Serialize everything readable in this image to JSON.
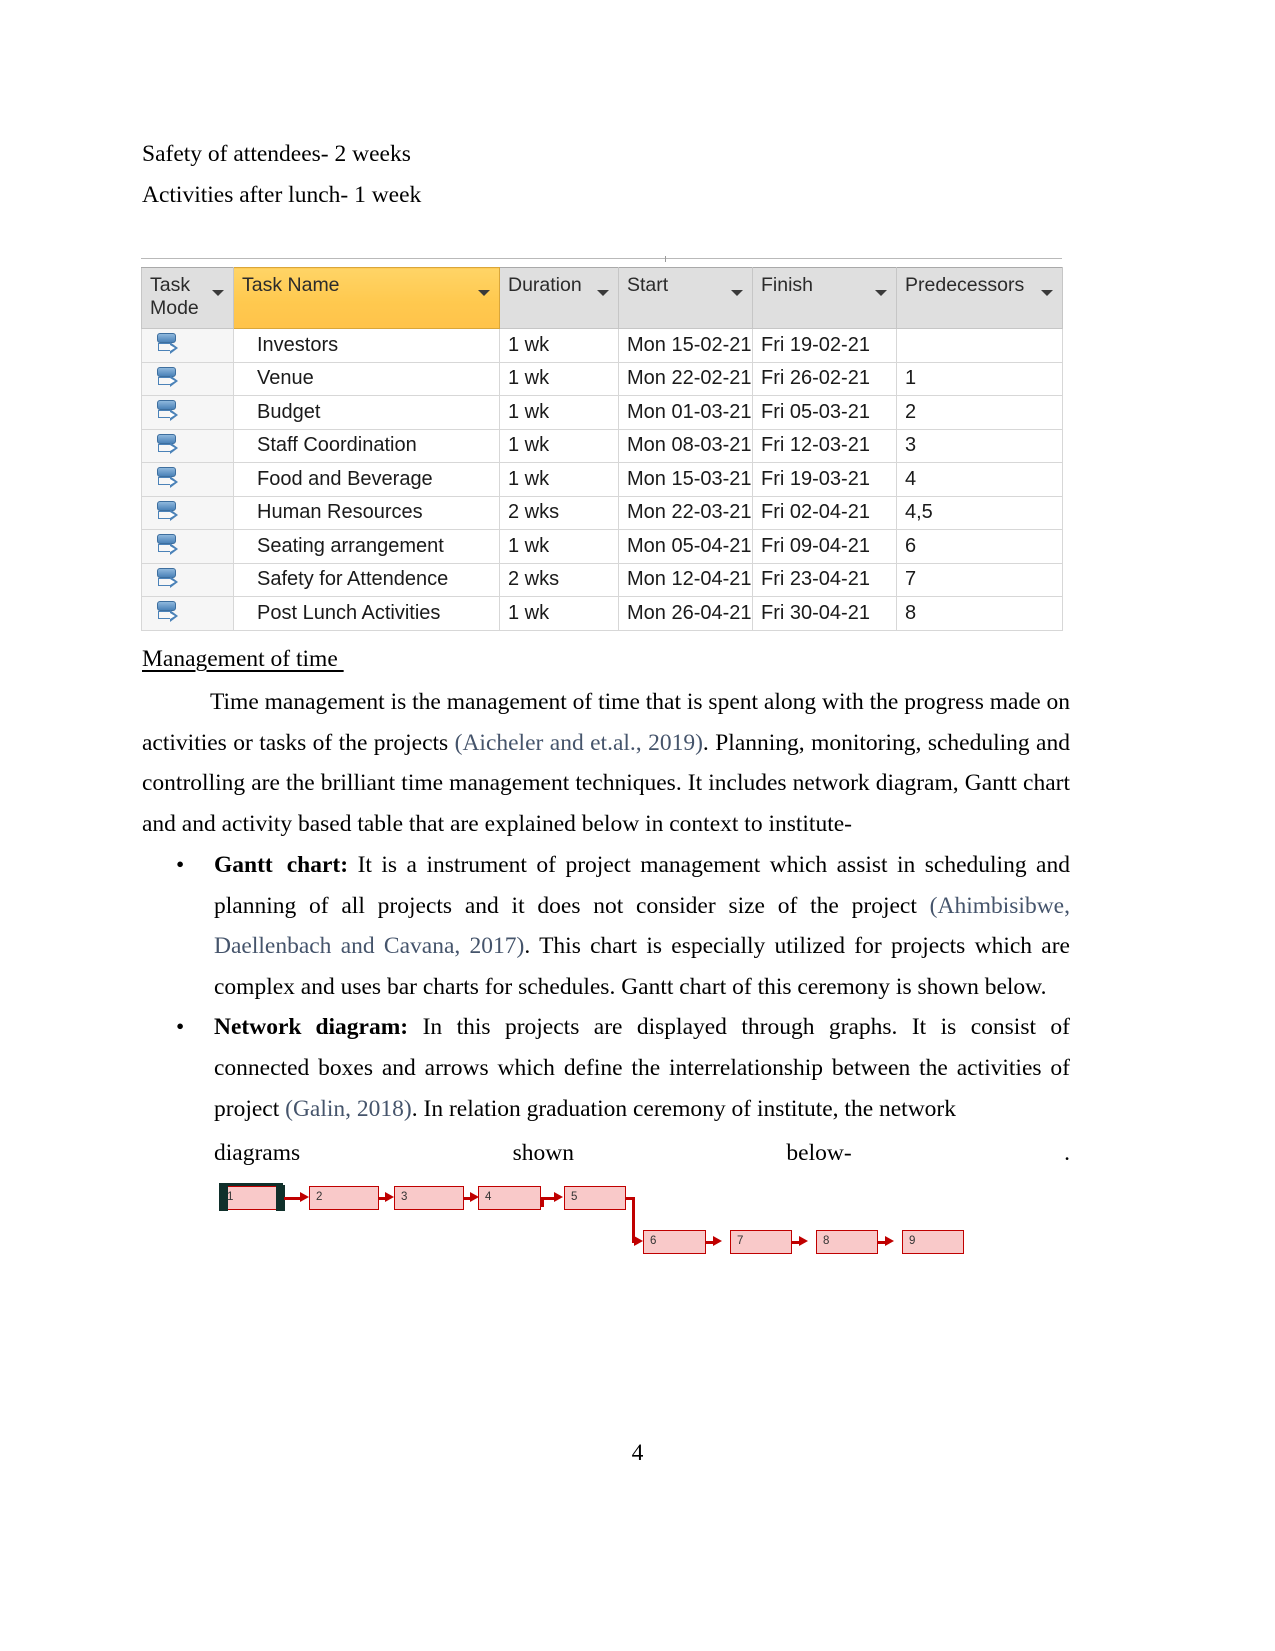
{
  "document": {
    "page_number": "4",
    "intro_lines": [
      "Safety of attendees- 2 weeks",
      "Activities after lunch- 1 week"
    ],
    "section_heading": "Management of time ",
    "paragraph": {
      "part1": "Time management is the management of time that is spent along with the progress made on activities or tasks of the projects ",
      "citation1": "(Aicheler and et.al., 2019)",
      "part2": ". Planning, monitoring, scheduling and controlling are the brilliant time management techniques. It includes network diagram, Gantt chart and and activity based table that are explained below in context to institute-"
    },
    "bullets": [
      {
        "marker": "•",
        "lead": "Gantt",
        "lead2": "chart:",
        "text1": " It is a instrument of project management which assist in scheduling and planning of all projects and it does not consider size of the project ",
        "citation": "(Ahimbisibwe, Daellenbach and Cavana, 2017)",
        "text2": ". This chart is especially utilized for projects which are complex and uses bar charts for schedules. Gantt chart of this ceremony is shown below."
      },
      {
        "marker": "•",
        "lead": "Network",
        "lead2": "diagram:",
        "text1": " In this projects are displayed through graphs. It is consist of connected boxes and arrows which define the interrelationship between the activities of project ",
        "citation": "(Galin, 2018)",
        "text2": ". In relation   graduation ceremony of institute, the network"
      }
    ],
    "tail_line": {
      "word1": "diagrams",
      "word2": "shown",
      "word3": "below-",
      "word4": "."
    }
  },
  "project_table": {
    "columns": [
      {
        "id": "task-mode",
        "label_line1": "Task",
        "label_line2": "Mode",
        "highlighted": false
      },
      {
        "id": "task-name",
        "label_line1": "Task Name",
        "label_line2": "",
        "highlighted": true
      },
      {
        "id": "duration",
        "label_line1": "Duration",
        "label_line2": "",
        "highlighted": false
      },
      {
        "id": "start",
        "label_line1": "Start",
        "label_line2": "",
        "highlighted": false
      },
      {
        "id": "finish",
        "label_line1": "Finish",
        "label_line2": "",
        "highlighted": false
      },
      {
        "id": "predecessors",
        "label_line1": "Predecessors",
        "label_line2": "",
        "highlighted": false
      }
    ],
    "highlight_color": "#ffc94f",
    "header_bg": "#dfdfdf",
    "rows": [
      {
        "mode_icon": "manually-scheduled-icon",
        "name": "Investors",
        "duration": "1 wk",
        "start": "Mon 15-02-21",
        "finish": "Fri 19-02-21",
        "predecessors": ""
      },
      {
        "mode_icon": "manually-scheduled-icon",
        "name": "Venue",
        "duration": "1 wk",
        "start": "Mon 22-02-21",
        "finish": "Fri 26-02-21",
        "predecessors": "1"
      },
      {
        "mode_icon": "manually-scheduled-icon",
        "name": "Budget",
        "duration": "1 wk",
        "start": "Mon 01-03-21",
        "finish": "Fri 05-03-21",
        "predecessors": "2"
      },
      {
        "mode_icon": "manually-scheduled-icon",
        "name": "Staff Coordination",
        "duration": "1 wk",
        "start": "Mon 08-03-21",
        "finish": "Fri 12-03-21",
        "predecessors": "3"
      },
      {
        "mode_icon": "manually-scheduled-icon",
        "name": "Food and Beverage",
        "duration": "1 wk",
        "start": "Mon 15-03-21",
        "finish": "Fri 19-03-21",
        "predecessors": "4"
      },
      {
        "mode_icon": "manually-scheduled-icon",
        "name": "Human Resources",
        "duration": "2 wks",
        "start": "Mon 22-03-21",
        "finish": "Fri 02-04-21",
        "predecessors": "4,5"
      },
      {
        "mode_icon": "manually-scheduled-icon",
        "name": "Seating arrangement",
        "duration": "1 wk",
        "start": "Mon 05-04-21",
        "finish": "Fri 09-04-21",
        "predecessors": "6"
      },
      {
        "mode_icon": "manually-scheduled-icon",
        "name": "Safety for Attendence",
        "duration": "2 wks",
        "start": "Mon 12-04-21",
        "finish": "Fri 23-04-21",
        "predecessors": "7"
      },
      {
        "mode_icon": "manually-scheduled-icon",
        "name": "Post Lunch Activities",
        "duration": "1 wk",
        "start": "Mon 26-04-21",
        "finish": "Fri 30-04-21",
        "predecessors": "8"
      }
    ]
  },
  "network_diagram": {
    "node_fill": "#f9c9c9",
    "node_border": "#c00000",
    "connector_color": "#c00000",
    "nodes": [
      {
        "label": "1",
        "selected": true
      },
      {
        "label": "2",
        "selected": false
      },
      {
        "label": "3",
        "selected": false
      },
      {
        "label": "4",
        "selected": false
      },
      {
        "label": "5",
        "selected": false
      },
      {
        "label": "6",
        "selected": false
      },
      {
        "label": "7",
        "selected": false
      },
      {
        "label": "8",
        "selected": false
      },
      {
        "label": "9",
        "selected": false
      }
    ],
    "edges": "1->2->3->4->5->6->7->8->9"
  }
}
